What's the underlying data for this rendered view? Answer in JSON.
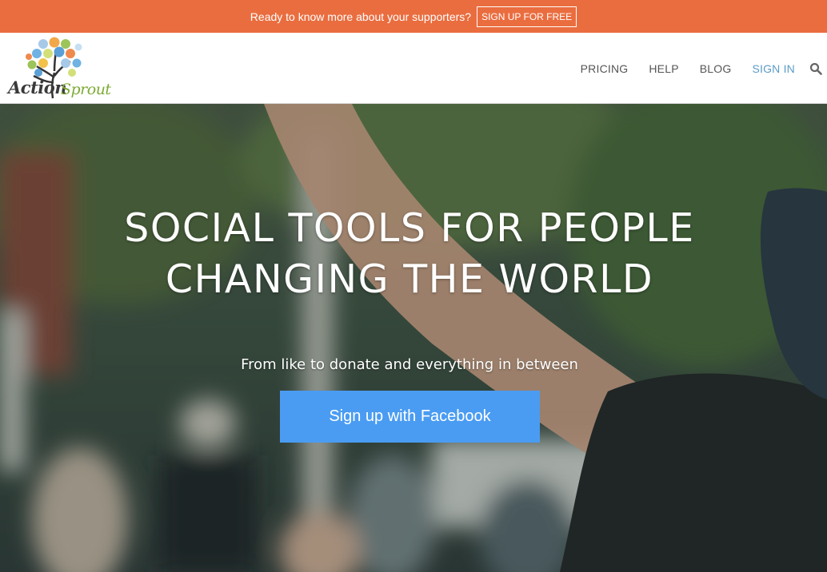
{
  "colors": {
    "promo_bg": "#ea6d3f",
    "facebook_button": "#4a9cf2",
    "nav_text": "#555555",
    "nav_active": "#5b9bc8"
  },
  "promo": {
    "text": "Ready to know more about your supporters?",
    "button": "SIGN UP FOR FREE"
  },
  "header": {
    "logo": {
      "word_1": "Action",
      "word_2": "Sprout"
    },
    "nav": {
      "pricing": "PRICING",
      "help": "HELP",
      "blog": "BLOG",
      "sign_in": "SIGN IN",
      "search_icon": "search-icon"
    }
  },
  "hero": {
    "title_line_1": "SOCIAL TOOLS FOR PEOPLE",
    "title_line_2": "CHANGING THE WORLD",
    "subtitle": "From like to donate and everything in between",
    "cta": "Sign up with Facebook"
  }
}
